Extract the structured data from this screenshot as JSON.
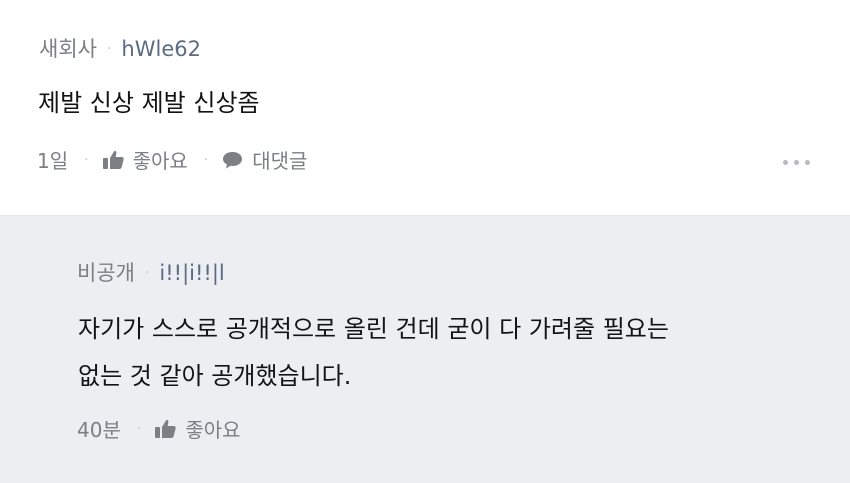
{
  "comment": {
    "org": "새회사",
    "nickname": "hWle62",
    "text": "제발 신상 제발 신상좀",
    "time": "1일",
    "like_label": "좋아요",
    "reply_label": "대댓글"
  },
  "reply": {
    "org": "비공개",
    "nickname": "i!!|i!!|l",
    "text_line1": "자기가 스스로 공개적으로 올린 건데 굳이 다 가려줄 필요는",
    "text_line2": "없는 것 같아 공개했습니다.",
    "time": "40분",
    "like_label": "좋아요"
  },
  "separator": "·",
  "icons": {
    "like": "thumbs-up-icon",
    "reply": "speech-bubble-icon",
    "more": "more-dots-icon"
  },
  "colors": {
    "reply_background": "#eceef2",
    "meta_text": "#7c7f83",
    "nickname_text": "#5a6b85",
    "body_text": "#141414"
  }
}
